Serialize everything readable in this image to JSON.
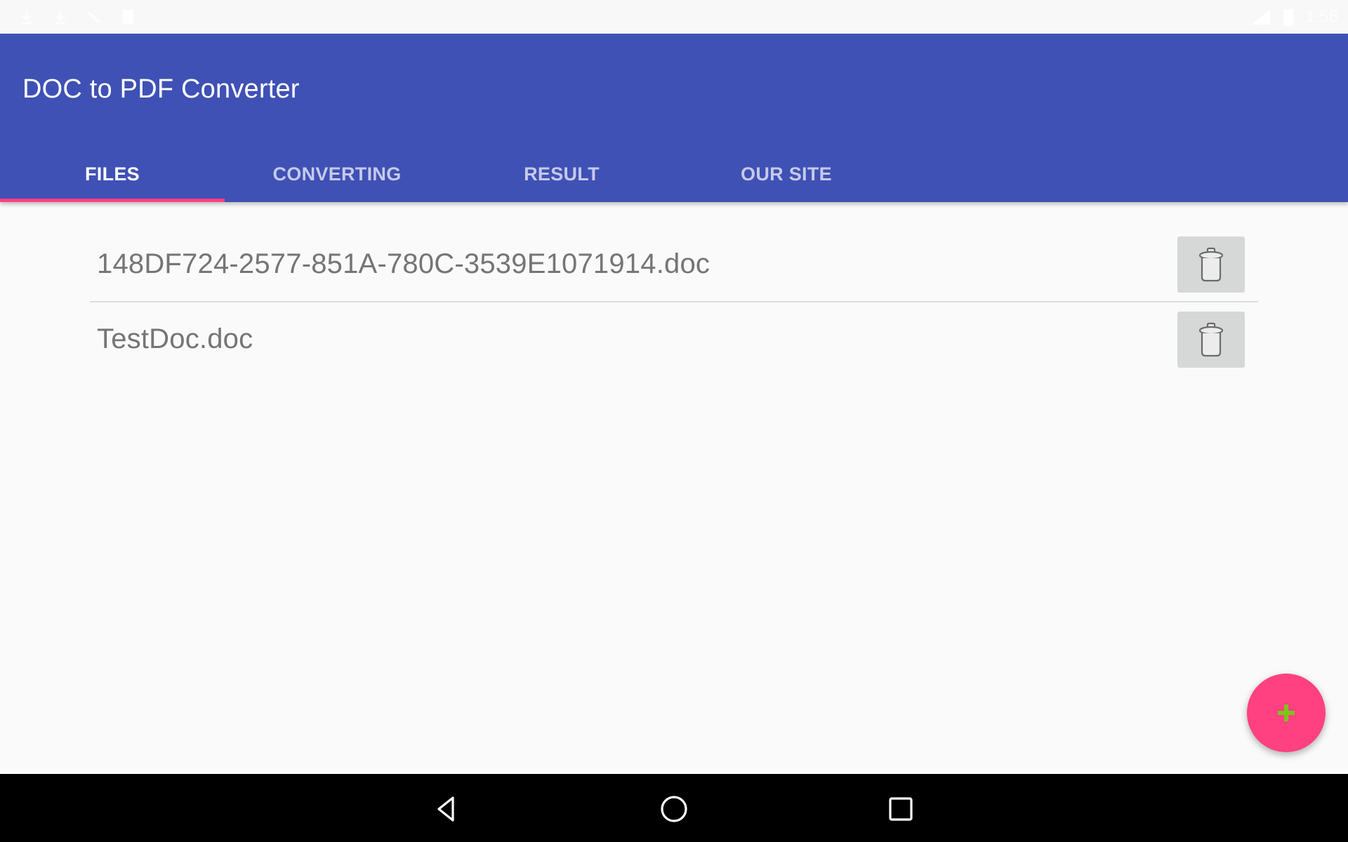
{
  "status_bar": {
    "left_icons": [
      "download-icon",
      "download-icon",
      "no-sim-icon",
      "sd-card-icon"
    ],
    "right_icons": [
      "wifi-signal-icon",
      "battery-icon"
    ],
    "time": "1:58"
  },
  "app_bar": {
    "title": "DOC to PDF Converter",
    "background_color": "#3f51b5"
  },
  "tabs": [
    {
      "label": "FILES",
      "active": true
    },
    {
      "label": "CONVERTING",
      "active": false
    },
    {
      "label": "RESULT",
      "active": false
    },
    {
      "label": "OUR SITE",
      "active": false
    }
  ],
  "tab_indicator_color": "#ff4081",
  "files": [
    {
      "name": "148DF724-2577-851A-780C-3539E1071914.doc",
      "action_icon": "trash-icon"
    },
    {
      "name": "TestDoc.doc",
      "action_icon": "trash-icon"
    }
  ],
  "fab": {
    "icon": "plus-icon",
    "background_color": "#ff4081",
    "icon_color": "#7cc41a"
  },
  "nav_bar": {
    "buttons": [
      "back-icon",
      "home-icon",
      "recents-icon"
    ]
  }
}
